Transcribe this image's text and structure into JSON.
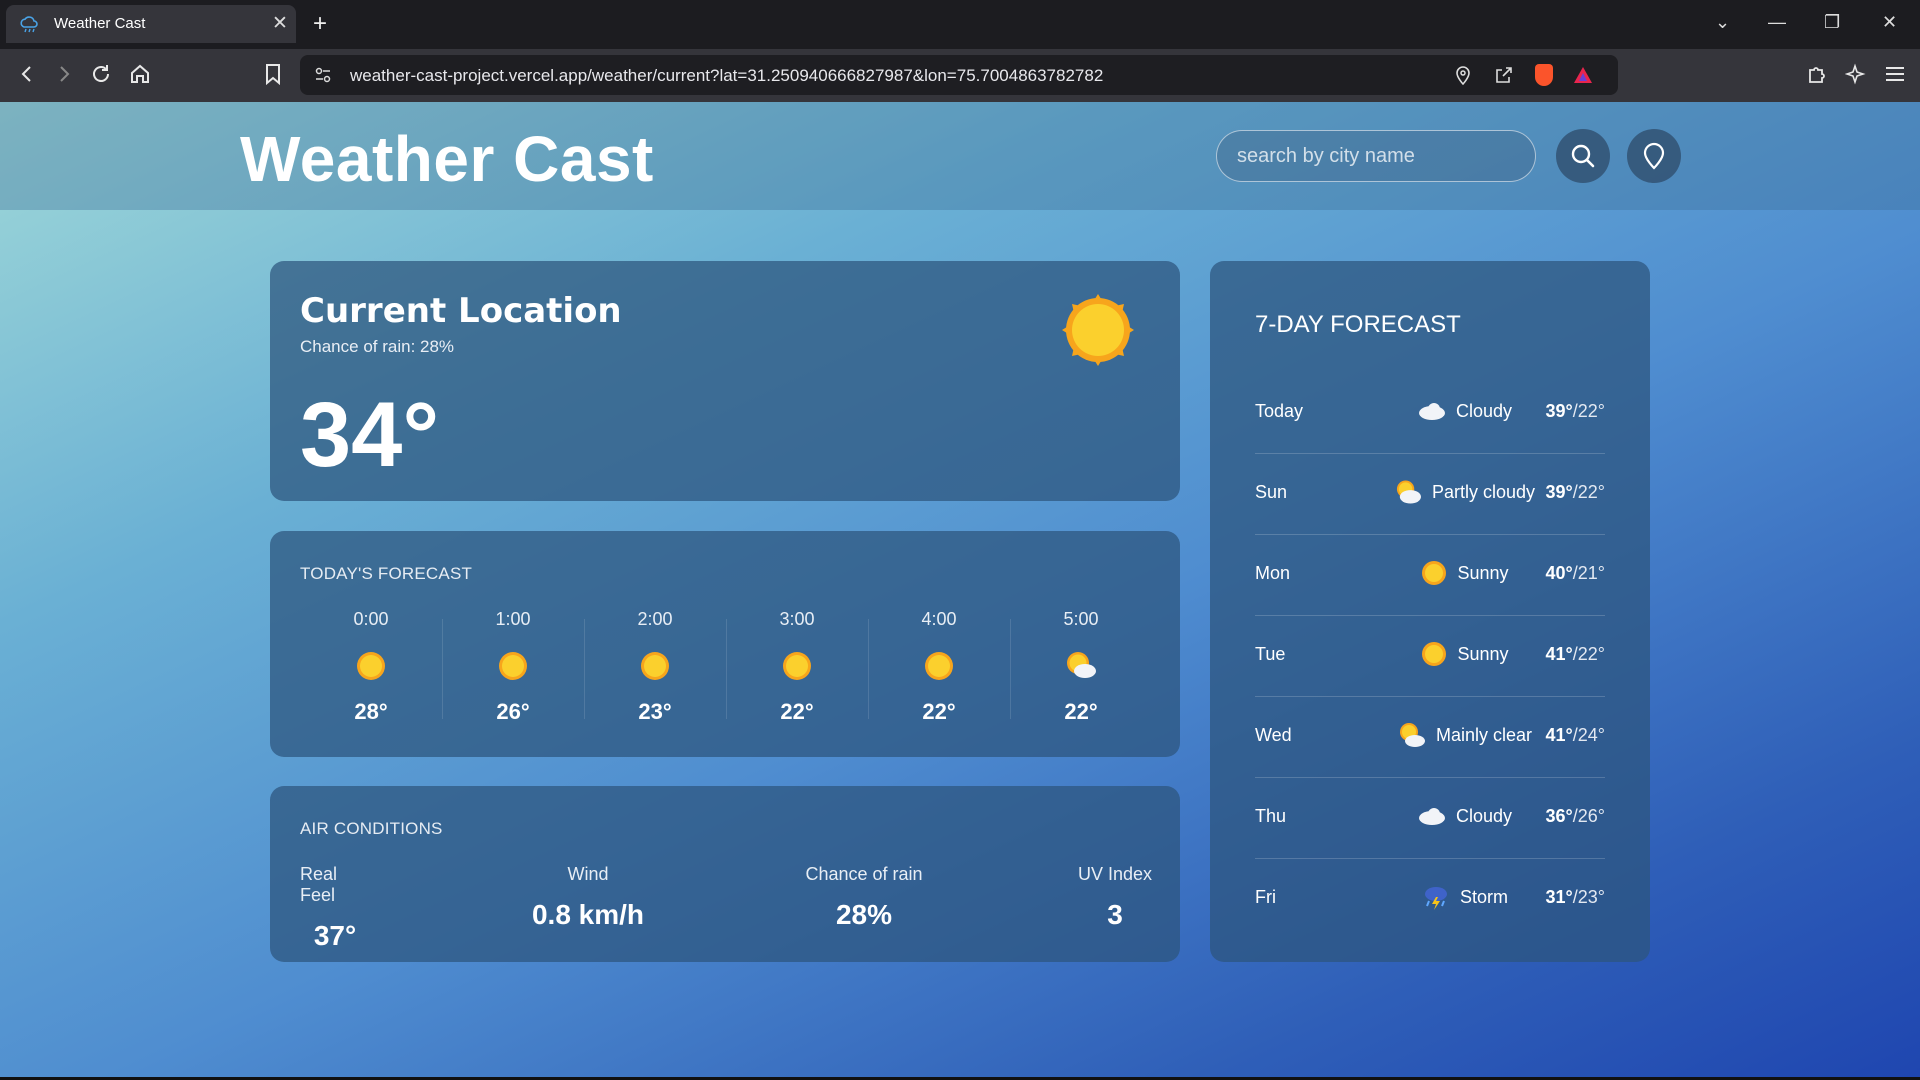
{
  "browser": {
    "tab_title": "Weather Cast",
    "url": "weather-cast-project.vercel.app/weather/current?lat=31.250940666827987&lon=75.7004863782782"
  },
  "header": {
    "logo": "Weather Cast",
    "search_placeholder": "search by city name"
  },
  "current": {
    "title": "Current Location",
    "rain_text": "Chance of rain: 28%",
    "temp": "34°",
    "icon": "sun-icon"
  },
  "today": {
    "label": "TODAY'S FORECAST",
    "hours": [
      {
        "time": "0:00",
        "temp": "28°",
        "icon": "sun-icon"
      },
      {
        "time": "1:00",
        "temp": "26°",
        "icon": "sun-icon"
      },
      {
        "time": "2:00",
        "temp": "23°",
        "icon": "sun-icon"
      },
      {
        "time": "3:00",
        "temp": "22°",
        "icon": "sun-icon"
      },
      {
        "time": "4:00",
        "temp": "22°",
        "icon": "sun-icon"
      },
      {
        "time": "5:00",
        "temp": "22°",
        "icon": "partly-cloudy-icon"
      }
    ]
  },
  "air": {
    "label": "AIR CONDITIONS",
    "items": [
      {
        "label": "Real Feel",
        "value": "37°"
      },
      {
        "label": "Wind",
        "value": "0.8 km/h"
      },
      {
        "label": "Chance of rain",
        "value": "28%"
      },
      {
        "label": "UV Index",
        "value": "3"
      }
    ]
  },
  "forecast": {
    "title": "7-DAY FORECAST",
    "days": [
      {
        "day": "Today",
        "cond": "Cloudy",
        "hi": "39°",
        "lo": "/22°",
        "icon": "cloud-icon"
      },
      {
        "day": "Sun",
        "cond": "Partly cloudy",
        "hi": "39°",
        "lo": "/22°",
        "icon": "partly-cloudy-icon"
      },
      {
        "day": "Mon",
        "cond": "Sunny",
        "hi": "40°",
        "lo": "/21°",
        "icon": "sun-icon"
      },
      {
        "day": "Tue",
        "cond": "Sunny",
        "hi": "41°",
        "lo": "/22°",
        "icon": "sun-icon"
      },
      {
        "day": "Wed",
        "cond": "Mainly clear",
        "hi": "41°",
        "lo": "/24°",
        "icon": "partly-cloudy-icon"
      },
      {
        "day": "Thu",
        "cond": "Cloudy",
        "hi": "36°",
        "lo": "/26°",
        "icon": "cloud-icon"
      },
      {
        "day": "Fri",
        "cond": "Storm",
        "hi": "31°",
        "lo": "/23°",
        "icon": "storm-icon"
      }
    ]
  },
  "colors": {
    "sun": "#f6c419",
    "sun_ray": "#f7a51c",
    "accent_gradient_start": "#9fd8d8",
    "accent_gradient_end": "#1f46b0"
  }
}
